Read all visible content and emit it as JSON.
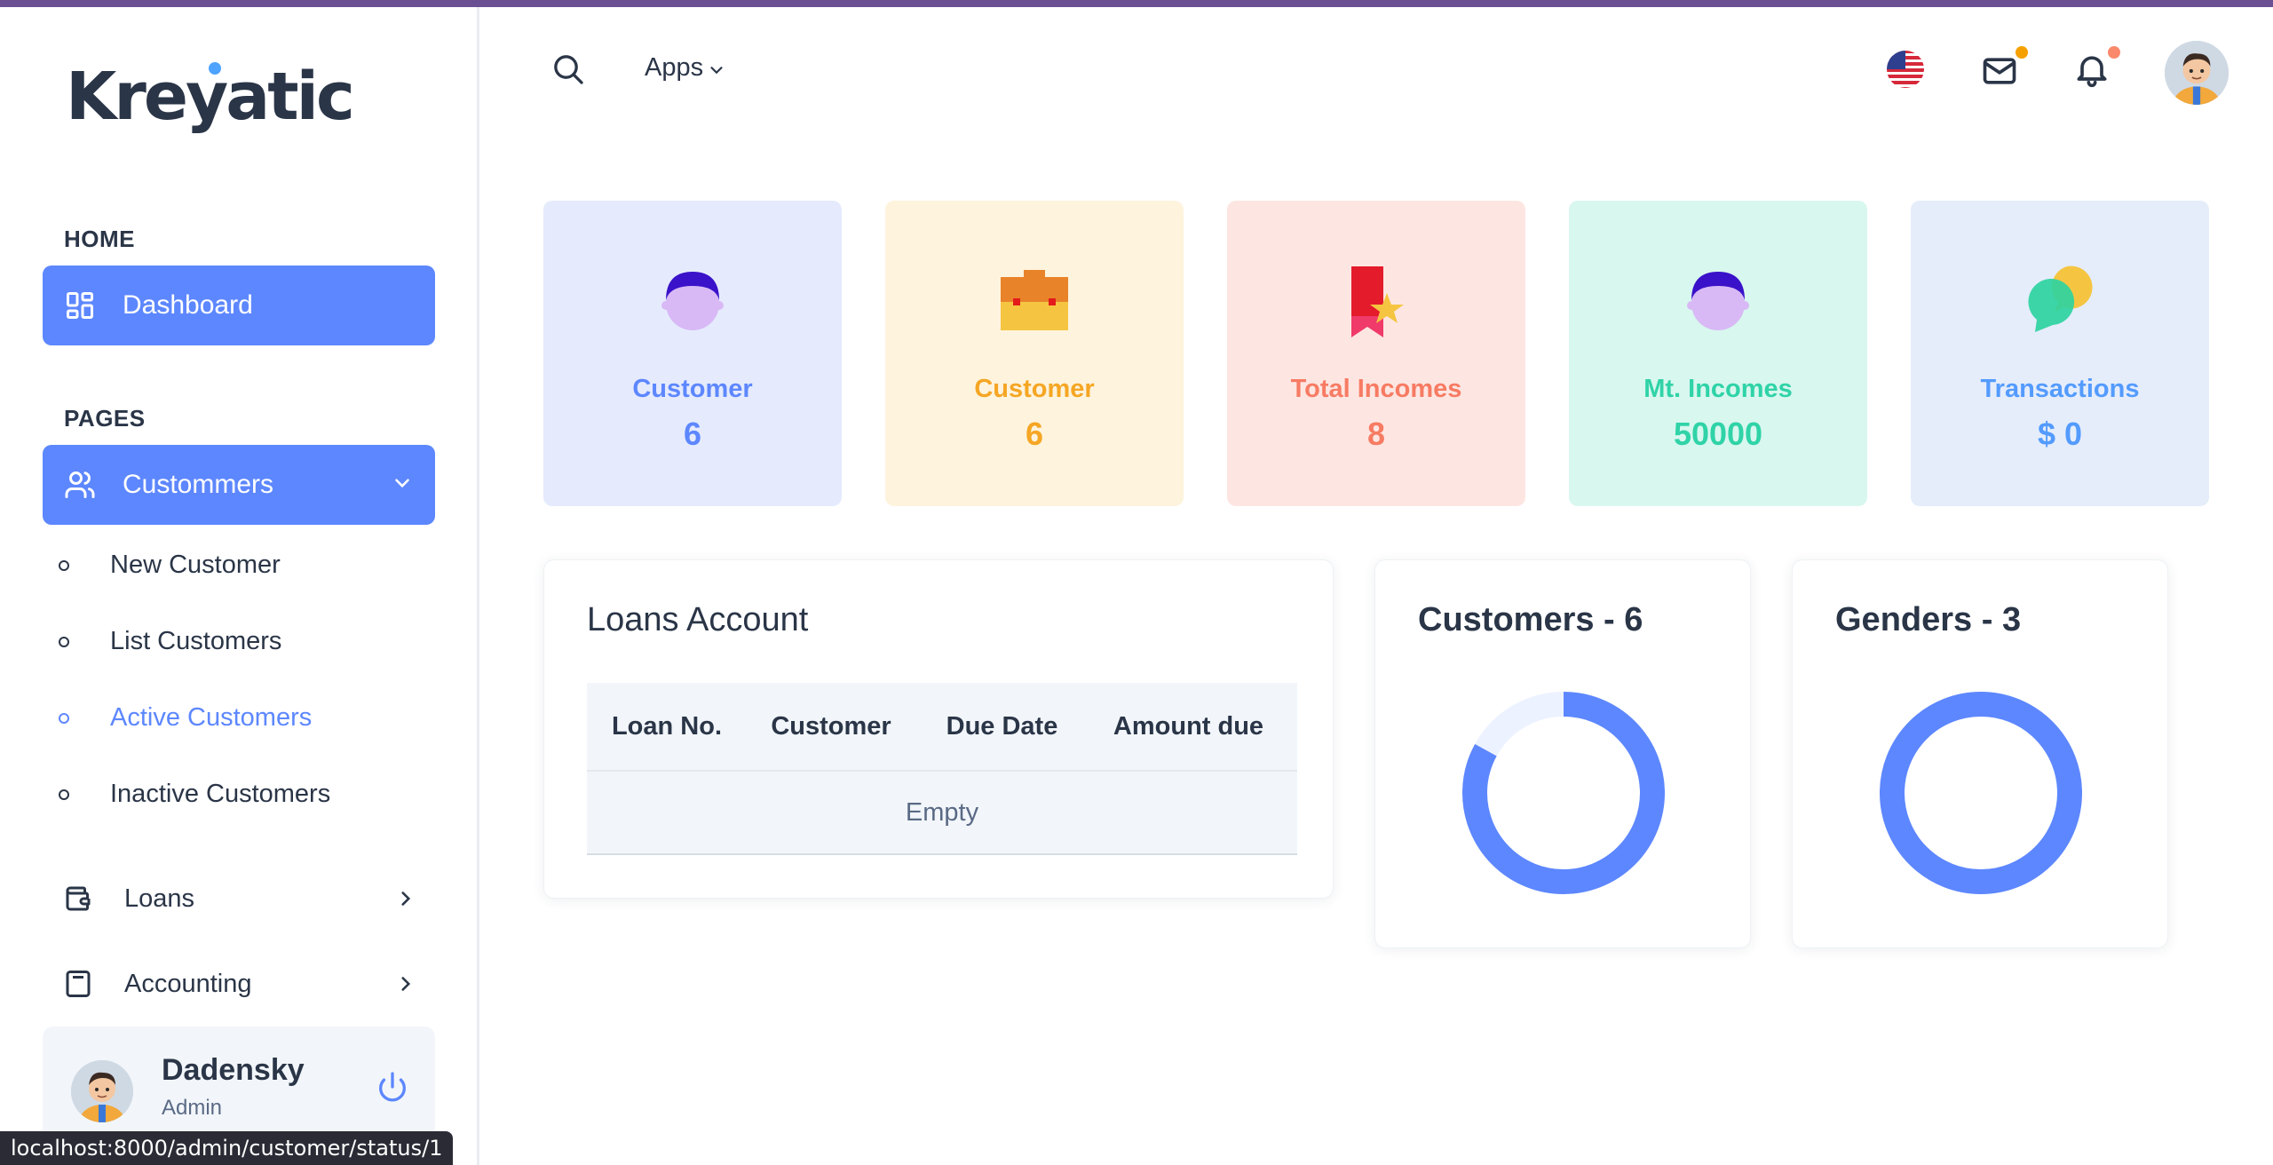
{
  "brand": {
    "logo_text_pre": "Kre",
    "logo_text_y": "y",
    "logo_text_post": "atic",
    "accent": "#5d87ff"
  },
  "sidebar": {
    "sections": [
      "HOME",
      "PAGES"
    ],
    "dashboard_label": "Dashboard",
    "customers_label": "Custommers",
    "customers_sub": [
      "New Customer",
      "List Customers",
      "Active Customers",
      "Inactive Customers"
    ],
    "active_sub_index": 2,
    "items": [
      "Loans",
      "Accounting"
    ],
    "user": {
      "name": "Dadensky",
      "role": "Admin"
    }
  },
  "statusbar": {
    "url": "localhost:8000/admin/customer/status/1"
  },
  "header": {
    "apps_label": "Apps",
    "icons": [
      "search-icon",
      "flag-us-icon",
      "mail-icon",
      "bell-icon",
      "avatar"
    ],
    "mail_dot_color": "#f6a000",
    "bell_dot_color": "#fa896b"
  },
  "stats": [
    {
      "title": "Customer",
      "value": "6",
      "bg": "#e5ebfd",
      "color": "#5d87ff",
      "icon": "person-icon"
    },
    {
      "title": "Customer",
      "value": "6",
      "bg": "#fef3dd",
      "color": "#f5a623",
      "icon": "briefcase-icon"
    },
    {
      "title": "Total Incomes",
      "value": "8",
      "bg": "#fde6e2",
      "color": "#f77b63",
      "icon": "award-icon"
    },
    {
      "title": "Mt. Incomes",
      "value": "50000",
      "bg": "#d8f7ef",
      "color": "#2fd3a7",
      "icon": "person-icon"
    },
    {
      "title": "Transactions",
      "value": "$ 0",
      "bg": "#e5edfb",
      "color": "#539bff",
      "icon": "chat-bubbles-icon"
    }
  ],
  "loans": {
    "title": "Loans Account",
    "columns": [
      "Loan No.",
      "Customer",
      "Due Date",
      "Amount due"
    ],
    "empty_text": "Empty"
  },
  "customers_panel": {
    "title": "Customers - 6"
  },
  "genders_panel": {
    "title": "Genders - 3"
  },
  "chart_data": [
    {
      "type": "pie",
      "title": "Customers - 6",
      "values": [
        0.83,
        0.17
      ],
      "colors": [
        "#5d87ff",
        "#ecf2ff"
      ]
    },
    {
      "type": "pie",
      "title": "Genders - 3",
      "values": [
        1.0
      ],
      "colors": [
        "#5d87ff"
      ]
    }
  ]
}
